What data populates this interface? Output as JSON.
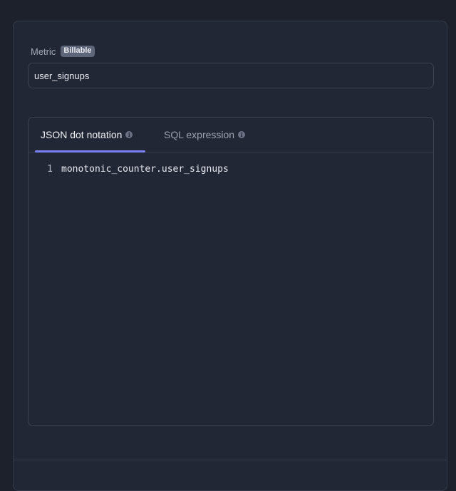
{
  "metric": {
    "label": "Metric",
    "badge": "Billable",
    "value": "user_signups"
  },
  "editor": {
    "tabs": [
      {
        "label": "JSON dot notation",
        "active": true,
        "icon": "info-icon"
      },
      {
        "label": "SQL expression",
        "active": false,
        "icon": "info-icon"
      }
    ],
    "lines": [
      {
        "number": "1",
        "text": "monotonic_counter.user_signups"
      }
    ]
  },
  "colors": {
    "background": "#1d212c",
    "panel": "#222735",
    "border": "#3c4354",
    "accent": "#7b82f5",
    "badge": "#5d6579"
  }
}
